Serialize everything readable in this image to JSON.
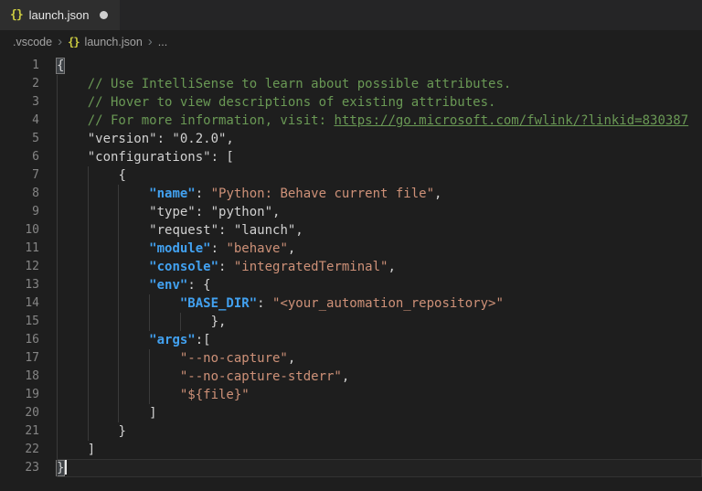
{
  "tab": {
    "label": "launch.json",
    "icon_glyph": "{}",
    "modified": true
  },
  "breadcrumb": {
    "folder": ".vscode",
    "file": "launch.json",
    "symbol": "...",
    "separator": "›"
  },
  "colors": {
    "editor_bg": "#1e1e1e",
    "tabbar_bg": "#252526",
    "tab_bg": "#2e2e2e",
    "comment_green": "#6a9955",
    "key_blue": "#42a1f0",
    "string_orange": "#ce9178",
    "text_gray": "#d1d1d1",
    "line_number_gray": "#858585",
    "json_icon_yellow": "#cbcb41"
  },
  "editor": {
    "language": "json",
    "line_count": 23,
    "lines": [
      {
        "n": 1,
        "indent": 0,
        "tokens": [
          {
            "c": "p",
            "t": "{",
            "m": true
          }
        ]
      },
      {
        "n": 2,
        "indent": 4,
        "tokens": [
          {
            "c": "cm",
            "t": "// Use IntelliSense to learn about possible attributes."
          }
        ]
      },
      {
        "n": 3,
        "indent": 4,
        "tokens": [
          {
            "c": "cm",
            "t": "// Hover to view descriptions of existing attributes."
          }
        ]
      },
      {
        "n": 4,
        "indent": 4,
        "tokens": [
          {
            "c": "cm",
            "t": "// For more information, visit: "
          },
          {
            "c": "lk",
            "t": "https://go.microsoft.com/fwlink/?linkid=830387"
          }
        ]
      },
      {
        "n": 5,
        "indent": 4,
        "tokens": [
          {
            "c": "p",
            "t": "\"version\": \"0.2.0\","
          }
        ]
      },
      {
        "n": 6,
        "indent": 4,
        "tokens": [
          {
            "c": "p",
            "t": "\"configurations\": ["
          }
        ]
      },
      {
        "n": 7,
        "indent": 8,
        "tokens": [
          {
            "c": "p",
            "t": "{"
          }
        ]
      },
      {
        "n": 8,
        "indent": 12,
        "tokens": [
          {
            "c": "k",
            "t": "\"name\""
          },
          {
            "c": "p",
            "t": ": "
          },
          {
            "c": "s",
            "t": "\"Python: Behave current file\""
          },
          {
            "c": "p",
            "t": ","
          }
        ]
      },
      {
        "n": 9,
        "indent": 12,
        "tokens": [
          {
            "c": "p",
            "t": "\"type\": \"python\","
          }
        ]
      },
      {
        "n": 10,
        "indent": 12,
        "tokens": [
          {
            "c": "p",
            "t": "\"request\": \"launch\","
          }
        ]
      },
      {
        "n": 11,
        "indent": 12,
        "tokens": [
          {
            "c": "k",
            "t": "\"module\""
          },
          {
            "c": "p",
            "t": ": "
          },
          {
            "c": "s",
            "t": "\"behave\""
          },
          {
            "c": "p",
            "t": ","
          }
        ]
      },
      {
        "n": 12,
        "indent": 12,
        "tokens": [
          {
            "c": "k",
            "t": "\"console\""
          },
          {
            "c": "p",
            "t": ": "
          },
          {
            "c": "s",
            "t": "\"integratedTerminal\""
          },
          {
            "c": "p",
            "t": ","
          }
        ]
      },
      {
        "n": 13,
        "indent": 12,
        "tokens": [
          {
            "c": "k",
            "t": "\"env\""
          },
          {
            "c": "p",
            "t": ": {"
          }
        ]
      },
      {
        "n": 14,
        "indent": 16,
        "tokens": [
          {
            "c": "k",
            "t": "\"BASE_DIR\""
          },
          {
            "c": "p",
            "t": ": "
          },
          {
            "c": "s",
            "t": "\"<your_automation_repository>\""
          }
        ]
      },
      {
        "n": 15,
        "indent": 20,
        "tokens": [
          {
            "c": "p",
            "t": "},"
          }
        ]
      },
      {
        "n": 16,
        "indent": 12,
        "tokens": [
          {
            "c": "k",
            "t": "\"args\""
          },
          {
            "c": "p",
            "t": ":["
          }
        ]
      },
      {
        "n": 17,
        "indent": 16,
        "tokens": [
          {
            "c": "s",
            "t": "\"--no-capture\""
          },
          {
            "c": "p",
            "t": ","
          }
        ]
      },
      {
        "n": 18,
        "indent": 16,
        "tokens": [
          {
            "c": "s",
            "t": "\"--no-capture-stderr\""
          },
          {
            "c": "p",
            "t": ","
          }
        ]
      },
      {
        "n": 19,
        "indent": 16,
        "tokens": [
          {
            "c": "s",
            "t": "\"${file}\""
          }
        ]
      },
      {
        "n": 20,
        "indent": 12,
        "tokens": [
          {
            "c": "p",
            "t": "]"
          }
        ]
      },
      {
        "n": 21,
        "indent": 8,
        "tokens": [
          {
            "c": "p",
            "t": "}"
          }
        ]
      },
      {
        "n": 22,
        "indent": 4,
        "tokens": [
          {
            "c": "p",
            "t": "]"
          }
        ]
      },
      {
        "n": 23,
        "indent": 0,
        "tokens": [
          {
            "c": "p",
            "t": "}",
            "m": true
          }
        ],
        "cursor": true,
        "current": true
      }
    ]
  }
}
